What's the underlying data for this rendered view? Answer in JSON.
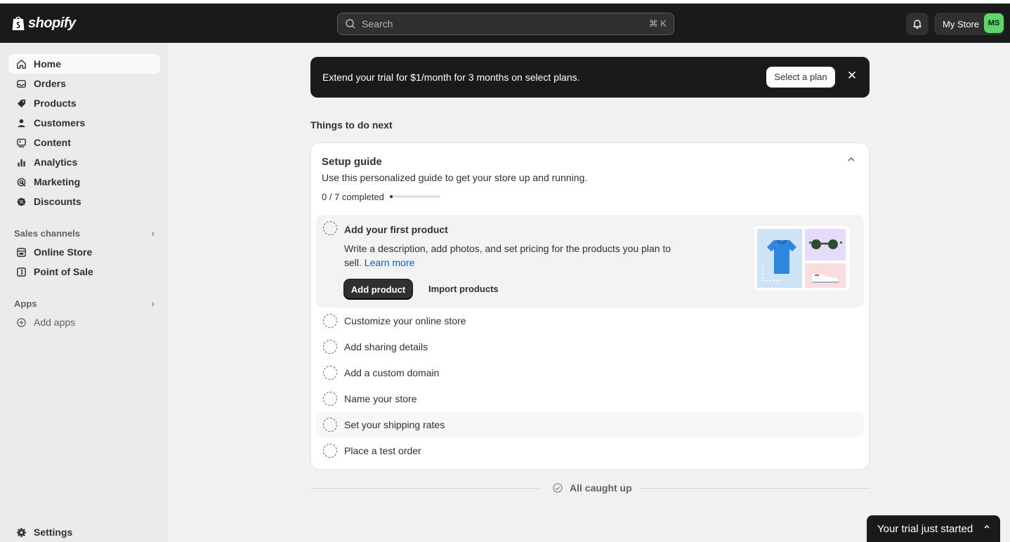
{
  "topbar": {
    "brand": "shopify",
    "search_placeholder": "Search",
    "search_shortcut": "⌘ K",
    "bell_icon": "bell-icon",
    "store_name": "My Store",
    "avatar_initials": "MS",
    "avatar_color": "#5bd66b"
  },
  "sidebar": {
    "items": [
      {
        "label": "Home",
        "icon": "home-icon",
        "active": true
      },
      {
        "label": "Orders",
        "icon": "inbox-icon"
      },
      {
        "label": "Products",
        "icon": "tag-icon"
      },
      {
        "label": "Customers",
        "icon": "person-icon"
      },
      {
        "label": "Content",
        "icon": "image-icon"
      },
      {
        "label": "Analytics",
        "icon": "bar-chart-icon"
      },
      {
        "label": "Marketing",
        "icon": "target-icon"
      },
      {
        "label": "Discounts",
        "icon": "discount-icon"
      }
    ],
    "sales_channels_header": "Sales channels",
    "channels": [
      {
        "label": "Online Store",
        "icon": "storefront-icon"
      },
      {
        "label": "Point of Sale",
        "icon": "pos-icon"
      }
    ],
    "apps_header": "Apps",
    "add_apps": "Add apps",
    "settings": "Settings"
  },
  "banner": {
    "text": "Extend your trial for $1/month for 3 months on select plans.",
    "button": "Select a plan",
    "close": "✕"
  },
  "main": {
    "section_title": "Things to do next",
    "setup_guide": {
      "title": "Setup guide",
      "subtitle": "Use this personalized guide to get your store up and running.",
      "progress_text": "0 / 7 completed",
      "progress_completed": 0,
      "progress_total": 7,
      "expanded_task": {
        "title": "Add your first product",
        "description": "Write a description, add photos, and set pricing for the products you plan to sell.",
        "learn_more": "Learn more",
        "primary_button": "Add product",
        "secondary_button": "Import products"
      },
      "tasks": [
        {
          "label": "Customize your online store"
        },
        {
          "label": "Add sharing details"
        },
        {
          "label": "Add a custom domain"
        },
        {
          "label": "Name your store"
        },
        {
          "label": "Set your shipping rates"
        },
        {
          "label": "Place a test order"
        }
      ]
    },
    "caught_up": "All caught up"
  },
  "toast": {
    "text": "Your trial just started"
  },
  "colors": {
    "topbar_bg": "#1a1a1a",
    "sidebar_bg": "#ebebeb",
    "page_bg": "#f1f1f1",
    "link": "#005bd3"
  }
}
